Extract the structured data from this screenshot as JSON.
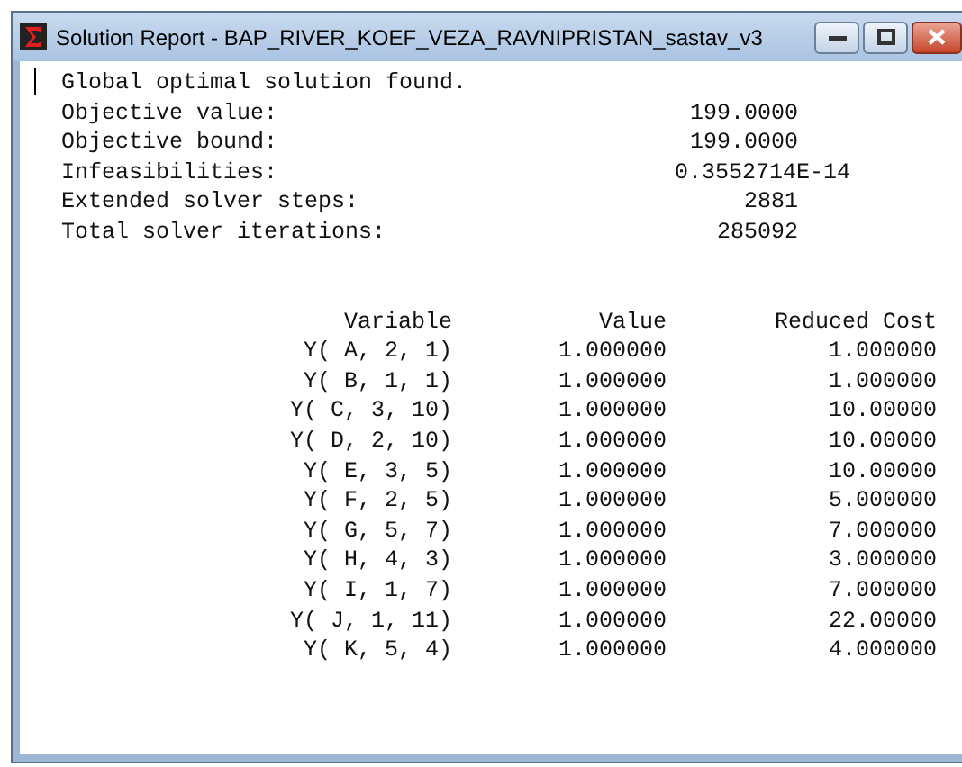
{
  "window": {
    "title": "Solution Report - BAP_RIVER_KOEF_VEZA_RAVNIPRISTAN_sastav_v3"
  },
  "report": {
    "status": "Global optimal solution found.",
    "summary": [
      {
        "label": "Objective value:",
        "value": "199.0000"
      },
      {
        "label": "Objective bound:",
        "value": "199.0000"
      },
      {
        "label": "Infeasibilities:",
        "value": "0.3552714E-14"
      },
      {
        "label": "Extended solver steps:",
        "value": "2881"
      },
      {
        "label": "Total solver iterations:",
        "value": "285092"
      }
    ],
    "table": {
      "columns": [
        "Variable",
        "Value",
        "Reduced Cost"
      ],
      "rows": [
        [
          "Y( A, 2, 1)",
          "1.000000",
          "1.000000"
        ],
        [
          "Y( B, 1, 1)",
          "1.000000",
          "1.000000"
        ],
        [
          "Y( C, 3, 10)",
          "1.000000",
          "10.00000"
        ],
        [
          "Y( D, 2, 10)",
          "1.000000",
          "10.00000"
        ],
        [
          "Y( E, 3, 5)",
          "1.000000",
          "10.00000"
        ],
        [
          "Y( F, 2, 5)",
          "1.000000",
          "5.000000"
        ],
        [
          "Y( G, 5, 7)",
          "1.000000",
          "7.000000"
        ],
        [
          "Y( H, 4, 3)",
          "1.000000",
          "3.000000"
        ],
        [
          "Y( I, 1, 7)",
          "1.000000",
          "7.000000"
        ],
        [
          "Y( J, 1, 11)",
          "1.000000",
          "22.00000"
        ],
        [
          "Y( K, 5, 4)",
          "1.000000",
          "4.000000"
        ]
      ]
    }
  }
}
